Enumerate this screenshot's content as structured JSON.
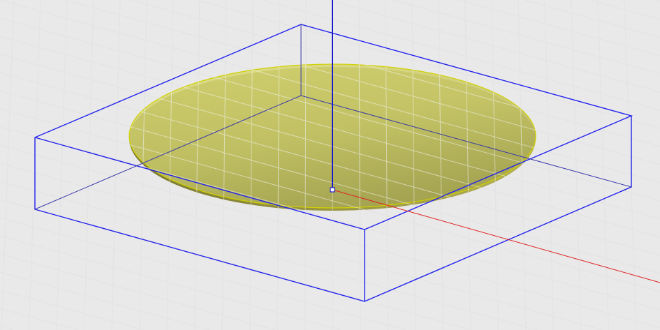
{
  "viewport": {
    "background_color": "#e9e9e9",
    "grid_color": "#d2d2d2",
    "box_edge_color": "#2222ee",
    "disc_fill_color": "#d8d86a",
    "disc_edge_color": "#d0d000",
    "z_axis_color": "#1a1acc",
    "x_axis_color": "#e02020"
  }
}
